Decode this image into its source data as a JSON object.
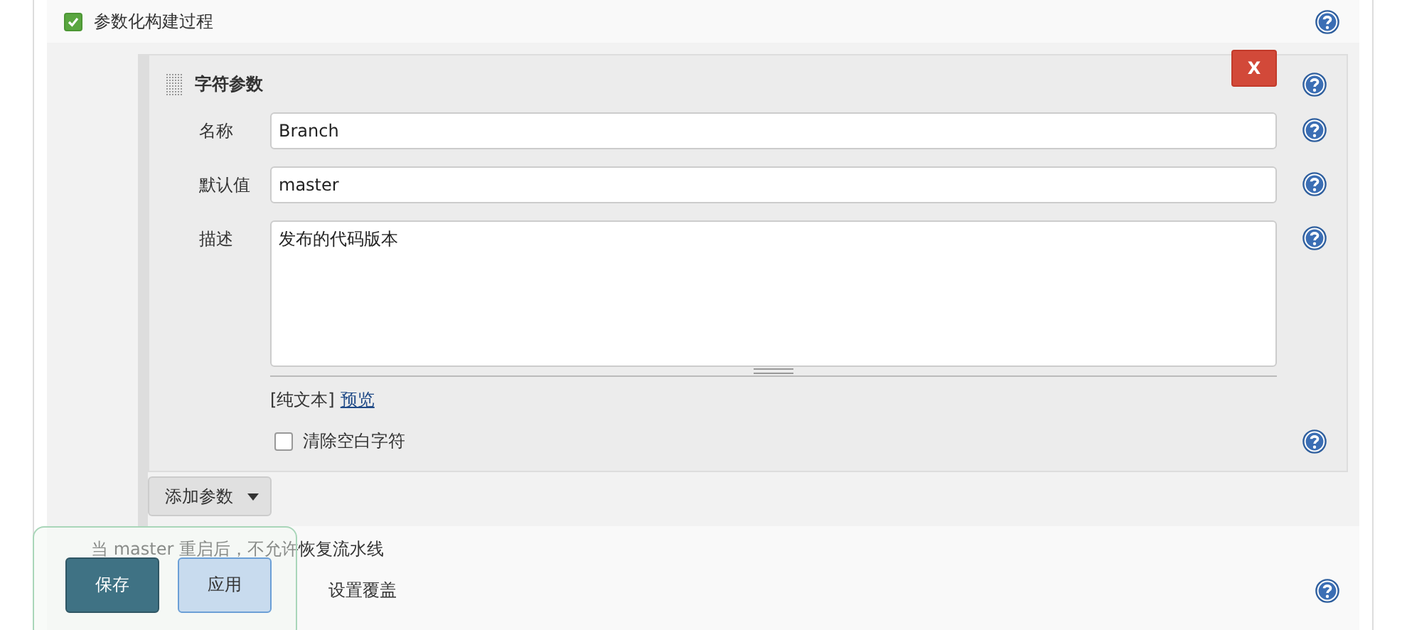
{
  "section": {
    "label": "参数化构建过程",
    "checked": true
  },
  "parameter": {
    "title": "字符参数",
    "delete_label": "X",
    "fields": [
      {
        "label": "名称",
        "kind": "input",
        "value": "Branch"
      },
      {
        "label": "默认值",
        "kind": "input",
        "value": "master"
      },
      {
        "label": "描述",
        "kind": "textarea",
        "value": "发布的代码版本"
      }
    ],
    "format": {
      "plain": "[纯文本]",
      "preview_link": "预览"
    },
    "trim": {
      "label": "清除空白字符",
      "checked": false
    }
  },
  "add_button": "添加参数",
  "options": [
    {
      "label": "当 master 重启后，不允许恢复流水线"
    },
    {
      "label": "设置覆盖"
    }
  ],
  "footer_buttons": [
    {
      "label": "保存",
      "kind": "primary"
    },
    {
      "label": "应用",
      "kind": "secondary"
    }
  ]
}
